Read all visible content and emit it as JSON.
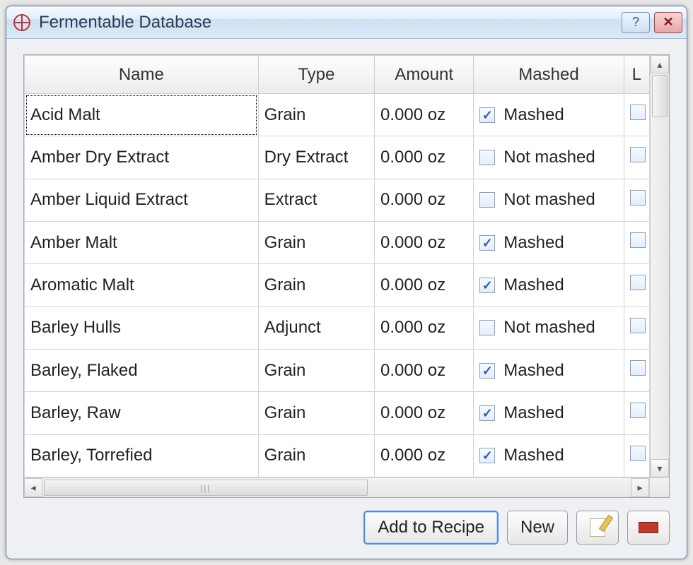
{
  "window": {
    "title": "Fermentable Database"
  },
  "columns": {
    "name": "Name",
    "type": "Type",
    "amount": "Amount",
    "mashed": "Mashed",
    "l": "L"
  },
  "mashed_labels": {
    "true": "Mashed",
    "false": "Not mashed"
  },
  "rows": [
    {
      "name": "Acid Malt",
      "type": "Grain",
      "amount": "0.000 oz",
      "mashed": true,
      "l": false
    },
    {
      "name": "Amber Dry Extract",
      "type": "Dry Extract",
      "amount": "0.000 oz",
      "mashed": false,
      "l": false
    },
    {
      "name": "Amber Liquid Extract",
      "type": "Extract",
      "amount": "0.000 oz",
      "mashed": false,
      "l": false
    },
    {
      "name": "Amber Malt",
      "type": "Grain",
      "amount": "0.000 oz",
      "mashed": true,
      "l": false
    },
    {
      "name": "Aromatic Malt",
      "type": "Grain",
      "amount": "0.000 oz",
      "mashed": true,
      "l": false
    },
    {
      "name": "Barley Hulls",
      "type": "Adjunct",
      "amount": "0.000 oz",
      "mashed": false,
      "l": false
    },
    {
      "name": "Barley, Flaked",
      "type": "Grain",
      "amount": "0.000 oz",
      "mashed": true,
      "l": false
    },
    {
      "name": "Barley, Raw",
      "type": "Grain",
      "amount": "0.000 oz",
      "mashed": true,
      "l": false
    },
    {
      "name": "Barley, Torrefied",
      "type": "Grain",
      "amount": "0.000 oz",
      "mashed": true,
      "l": false
    }
  ],
  "buttons": {
    "add_to_recipe": "Add to Recipe",
    "new": "New"
  }
}
